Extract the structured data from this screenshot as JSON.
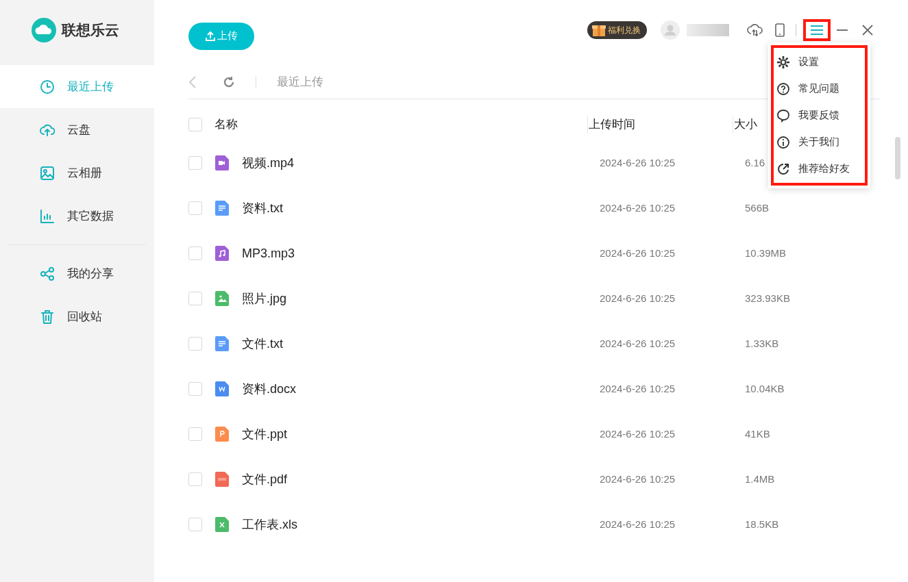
{
  "app": {
    "name": "联想乐云"
  },
  "sidebar": {
    "items": [
      {
        "label": "最近上传",
        "kind": "clock",
        "selected": true
      },
      {
        "label": "云盘",
        "kind": "cloud",
        "selected": false
      },
      {
        "label": "云相册",
        "kind": "image",
        "selected": false
      },
      {
        "label": "其它数据",
        "kind": "chart",
        "selected": false
      },
      {
        "label": "我的分享",
        "kind": "share",
        "selected": false
      },
      {
        "label": "回收站",
        "kind": "trash",
        "selected": false
      }
    ]
  },
  "toolbar": {
    "upload_button": "上传",
    "badge": "福利兑换",
    "menu_button": {
      "highlighted": true
    }
  },
  "breadcrumb": "最近上传",
  "table": {
    "select_all_checked": false,
    "columns": [
      "名称",
      "上传时间",
      "大小"
    ],
    "rows": [
      {
        "name": "视频.mp4",
        "kind": "video",
        "time": "2024-6-26 10:25",
        "size": "6.16",
        "checked": false
      },
      {
        "name": "资料.txt",
        "kind": "text",
        "time": "2024-6-26 10:25",
        "size": "566B",
        "checked": false
      },
      {
        "name": "MP3.mp3",
        "kind": "audio",
        "time": "2024-6-26 10:25",
        "size": "10.39MB",
        "checked": false
      },
      {
        "name": "照片.jpg",
        "kind": "image",
        "time": "2024-6-26 10:25",
        "size": "323.93KB",
        "checked": false
      },
      {
        "name": "文件.txt",
        "kind": "text",
        "time": "2024-6-26 10:25",
        "size": "1.33KB",
        "checked": false
      },
      {
        "name": "资料.docx",
        "kind": "word",
        "time": "2024-6-26 10:25",
        "size": "10.04KB",
        "checked": false
      },
      {
        "name": "文件.ppt",
        "kind": "ppt",
        "time": "2024-6-26 10:25",
        "size": "41KB",
        "checked": false
      },
      {
        "name": "文件.pdf",
        "kind": "pdf",
        "time": "2024-6-26 10:25",
        "size": "1.4MB",
        "checked": false
      },
      {
        "name": "工作表.xls",
        "kind": "excel",
        "time": "2024-6-26 10:25",
        "size": "18.5KB",
        "checked": false
      }
    ]
  },
  "menu": {
    "highlighted": true,
    "items": [
      {
        "label": "设置",
        "kind": "gear"
      },
      {
        "label": "常见问题",
        "kind": "question"
      },
      {
        "label": "我要反馈",
        "kind": "chat"
      },
      {
        "label": "关于我们",
        "kind": "info"
      },
      {
        "label": "推荐给好友",
        "kind": "recommend"
      }
    ]
  }
}
